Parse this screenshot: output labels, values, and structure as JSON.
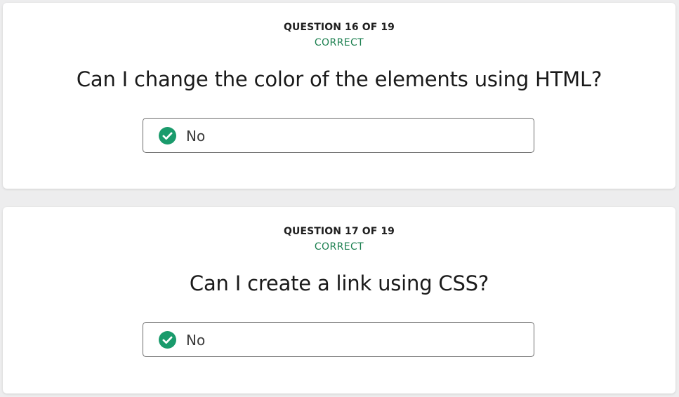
{
  "questions": [
    {
      "counter": "QUESTION 16 OF 19",
      "status": "CORRECT",
      "text": "Can I change the color of the elements using HTML?",
      "answer": "No"
    },
    {
      "counter": "QUESTION 17 OF 19",
      "status": "CORRECT",
      "text": "Can I create a link using CSS?",
      "answer": "No"
    }
  ],
  "colors": {
    "correct": "#1b7f4f",
    "check_badge": "#1a9b6c",
    "card_bg": "#ffffff",
    "page_bg": "#ededee"
  },
  "icons": {
    "answer_check": "check-circle-icon"
  }
}
